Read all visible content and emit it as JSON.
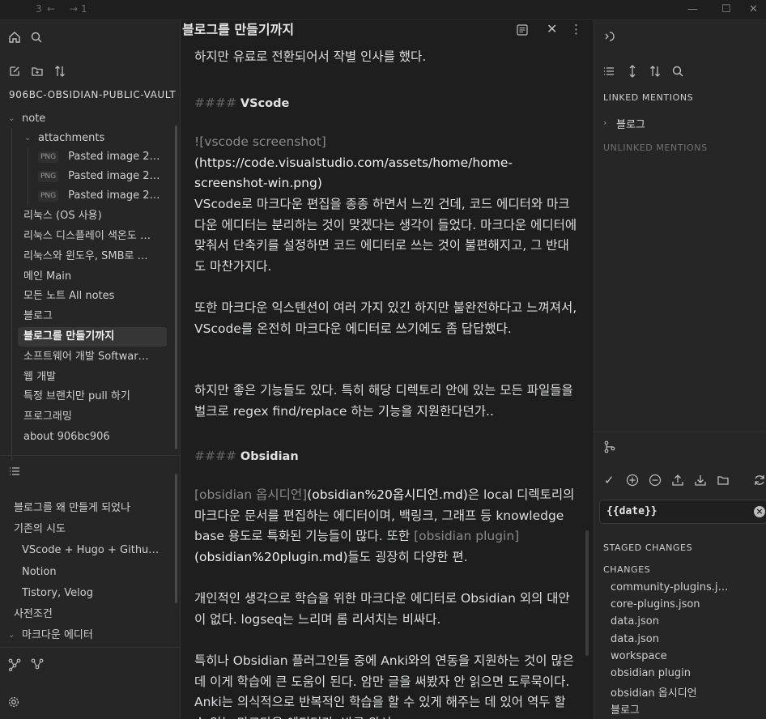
{
  "titlebar": {
    "back_count": "3",
    "forward_count": "1"
  },
  "sidebar": {
    "vault_name": "906BC-OBSIDIAN-PUBLIC-VAULT",
    "tree": [
      {
        "label": "note",
        "kind": "folder-open"
      },
      {
        "label": "attachments",
        "kind": "folder-open"
      },
      {
        "label": "Pasted image 2…",
        "kind": "file",
        "badge": "PNG"
      },
      {
        "label": "Pasted image 2…",
        "kind": "file",
        "badge": "PNG"
      },
      {
        "label": "Pasted image 2…",
        "kind": "file",
        "badge": "PNG"
      },
      {
        "label": "리눅스 (OS 사용)",
        "kind": "file"
      },
      {
        "label": "리눅스 디스플레이 색온도 …",
        "kind": "file"
      },
      {
        "label": "리눅스와 윈도우, SMB로 …",
        "kind": "file"
      },
      {
        "label": "메인 Main",
        "kind": "file"
      },
      {
        "label": "모든 노트 All notes",
        "kind": "file"
      },
      {
        "label": "블로그",
        "kind": "file"
      },
      {
        "label": "블로그를 만들기까지",
        "kind": "file",
        "active": true
      },
      {
        "label": "소프트웨어 개발 Softwar…",
        "kind": "file"
      },
      {
        "label": "웹 개발",
        "kind": "file"
      },
      {
        "label": "특정 브랜치만 pull 하기",
        "kind": "file"
      },
      {
        "label": "프로그래밍",
        "kind": "file"
      },
      {
        "label": "about 906bc906",
        "kind": "file"
      }
    ],
    "outline": [
      {
        "label": "블로그를 왜 만들게 되었나"
      },
      {
        "label": "기존의 시도"
      },
      {
        "label": "VScode + Hugo + Githu…"
      },
      {
        "label": "Notion"
      },
      {
        "label": "Tistory, Velog"
      },
      {
        "label": "사전조건"
      },
      {
        "label": "마크다운 에디터"
      }
    ]
  },
  "editor": {
    "title": "블로그를 만들기까지",
    "p1": "하지만 유료로 전환되어서 작별 인사를 했다.",
    "h_vscode_mark": "####",
    "h_vscode": "VScode",
    "img_bang": "!",
    "img_alt": "[vscode screenshot]",
    "img_url": "(https://code.visualstudio.com/assets/home/home-screenshot-win.png)",
    "p2": "VScode로 마크다운 편집을 종종 하면서 느낀 건데, 코드 에디터와 마크다운 에디터는 분리하는 것이 맞겠다는 생각이 들었다. 마크다운 에디터에 맞춰서 단축키를 설정하면 코드 에디터로 쓰는 것이 불편해지고, 그 반대도 마찬가지다.",
    "p3": "또한 마크다운 익스텐션이 여러 가지 있긴 하지만 불완전하다고 느껴져서, VScode를 온전히 마크다운 에디터로 쓰기에도 좀 답답했다.",
    "p4": "하지만 좋은 기능들도 있다. 특히 해당 디렉토리 안에 있는 모든 파일들을 벌크로 regex find/replace 하는 기능을 지원한다던가..",
    "h_obsidian_mark": "####",
    "h_obsidian": "Obsidian",
    "p5_link1": "[obsidian 옵시디언]",
    "p5_url1": "(obsidian%20옵시디언.md)",
    "p5_a": "은 local 디렉토리의 마크다운 문서를 편집하는 에디터이며, 백링크, 그래프 등 knowledge base 용도로 특화된 기능들이 많다. 또한 ",
    "p5_link2": "[obsidian plugin]",
    "p5_url2": "(obsidian%20plugin.md)",
    "p5_b": "들도 굉장히 다양한 편.",
    "p6": "개인적인 생각으로 학습을 위한 마크다운 에디터로 Obsidian 외의 대안이 없다. logseq는 느리며 롬 리서치는 비싸다.",
    "p7": "특히나 Obsidian 플러그인들 중에 Anki와의 연동을 지원하는 것이 많은데 이게 학습에 큰 도움이 된다. 암만 글을 써봤자 안 읽으면 도루묵이다. Anki는 의식적으로 반복적인 학습을 할 수 있게 해주는 데 있어 역두 할 수 있는 마크다운 에디터라, 바로 와서"
  },
  "rightbar": {
    "linked_mentions": "LINKED MENTIONS",
    "linked_item": "블로그",
    "unlinked_mentions": "UNLINKED MENTIONS",
    "commit_message": "{{date}}",
    "staged_changes": "STAGED CHANGES",
    "changes": "CHANGES",
    "change_files": [
      "community-plugins.j…",
      "core-plugins.json",
      "data.json",
      "data.json",
      "workspace",
      "obsidian plugin",
      "obsidian 옵시디언",
      "블로그"
    ]
  },
  "colors": {
    "background": "#1e1e1e",
    "sidebar": "#262626",
    "text": "#dcddde",
    "muted": "#8a8a8a",
    "active_row": "#363636"
  }
}
